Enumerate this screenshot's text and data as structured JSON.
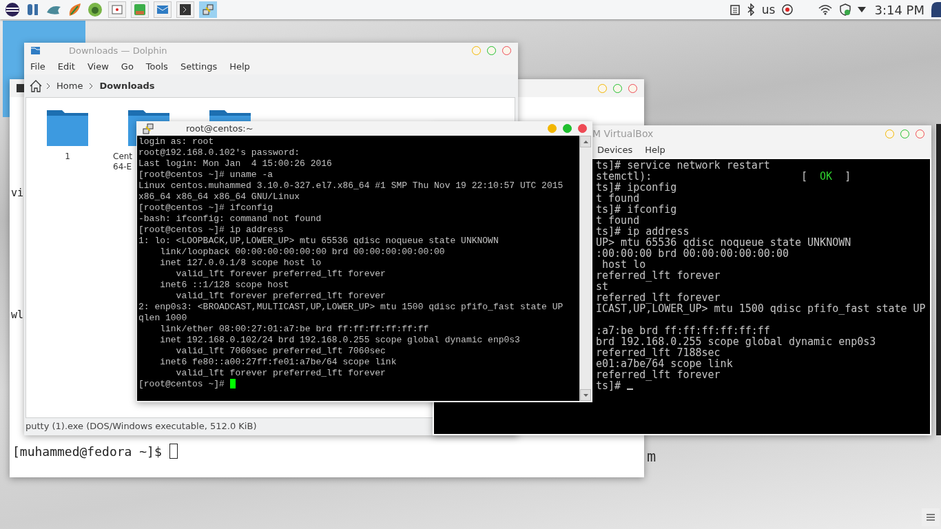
{
  "top_panel": {
    "tasks": [
      {
        "kind": "screenshot",
        "selected": false
      },
      {
        "kind": "calendar",
        "selected": false
      },
      {
        "kind": "mail",
        "selected": false
      },
      {
        "kind": "terminal",
        "selected": false
      },
      {
        "kind": "putty",
        "selected": true
      }
    ],
    "keyboard_layout": "us",
    "clock": "3:14 PM"
  },
  "back_terminal": {
    "active": false,
    "lines": [
      "vi",
      "wl"
    ],
    "prompt": {
      "text": "[muhammed@fedora ~]$",
      "cursor": true
    }
  },
  "desktop_fragment": "m",
  "dolphin": {
    "title": "Downloads — Dolphin",
    "active": false,
    "menu": [
      "File",
      "Edit",
      "View",
      "Go",
      "Tools",
      "Settings",
      "Help"
    ],
    "breadcrumb": [
      {
        "label": "Home",
        "current": false
      },
      {
        "label": "Downloads",
        "current": true
      }
    ],
    "items": [
      {
        "kind": "folder",
        "lines": [
          "1"
        ]
      },
      {
        "kind": "folder",
        "lines": [
          "Cent",
          "64-E"
        ]
      },
      {
        "kind": "folder"
      }
    ],
    "status": "putty (1).exe (DOS/Windows executable, 512.0 KiB)"
  },
  "virtualbox": {
    "title": "M VirtualBox",
    "active": false,
    "menu": [
      "Devices",
      "Help"
    ],
    "lines": [
      {
        "kind": "text",
        "text": "ts]# service network restart"
      },
      {
        "kind": "status",
        "text": "stemctl):",
        "open": "[",
        "status": "OK",
        "close": "]"
      },
      {
        "kind": "text",
        "text": "ts]# ipconfig"
      },
      {
        "kind": "text",
        "text": "t found"
      },
      {
        "kind": "text",
        "text": "ts]# ifconfig"
      },
      {
        "kind": "text",
        "text": "t found"
      },
      {
        "kind": "text",
        "text": "ts]# ip address"
      },
      {
        "kind": "text",
        "text": "UP> mtu 65536 qdisc noqueue state UNKNOWN"
      },
      {
        "kind": "text",
        "text": ":00:00:00 brd 00:00:00:00:00:00"
      },
      {
        "kind": "text",
        "text": " host lo"
      },
      {
        "kind": "text",
        "text": "referred_lft forever"
      },
      {
        "kind": "text",
        "text": "st"
      },
      {
        "kind": "text",
        "text": "referred_lft forever"
      },
      {
        "kind": "text",
        "text": "ICAST,UP,LOWER_UP> mtu 1500 qdisc pfifo_fast state UP"
      },
      {
        "kind": "blank"
      },
      {
        "kind": "text",
        "text": ":a7:be brd ff:ff:ff:ff:ff:ff"
      },
      {
        "kind": "text",
        "text": "brd 192.168.0.255 scope global dynamic enp0s3"
      },
      {
        "kind": "text",
        "text": "referred_lft 7188sec"
      },
      {
        "kind": "text",
        "text": "e01:a7be/64 scope link"
      },
      {
        "kind": "text",
        "text": "referred_lft forever"
      },
      {
        "kind": "prompt",
        "text": "ts]#",
        "cursor": true
      }
    ]
  },
  "putty": {
    "title": "root@centos:~",
    "active": true,
    "lines": [
      "login as: root",
      "root@192.168.0.102's password:",
      "Last login: Mon Jan  4 15:00:26 2016",
      "[root@centos ~]# uname -a",
      "Linux centos.muhammed 3.10.0-327.el7.x86_64 #1 SMP Thu Nov 19 22:10:57 UTC 2015",
      "x86_64 x86_64 x86_64 GNU/Linux",
      "[root@centos ~]# ifconfig",
      "-bash: ifconfig: command not found",
      "[root@centos ~]# ip address",
      "1: lo: <LOOPBACK,UP,LOWER_UP> mtu 65536 qdisc noqueue state UNKNOWN",
      "    link/loopback 00:00:00:00:00:00 brd 00:00:00:00:00:00",
      "    inet 127.0.0.1/8 scope host lo",
      "       valid_lft forever preferred_lft forever",
      "    inet6 ::1/128 scope host",
      "       valid_lft forever preferred_lft forever",
      "2: enp0s3: <BROADCAST,MULTICAST,UP,LOWER_UP> mtu 1500 qdisc pfifo_fast state UP",
      "qlen 1000",
      "    link/ether 08:00:27:01:a7:be brd ff:ff:ff:ff:ff:ff",
      "    inet 192.168.0.102/24 brd 192.168.0.255 scope global dynamic enp0s3",
      "       valid_lft 7060sec preferred_lft 7060sec",
      "    inet6 fe80::a00:27ff:fe01:a7be/64 scope link",
      "       valid_lft forever preferred_lft forever"
    ],
    "prompt": {
      "text": "[root@centos ~]#",
      "cursor": true
    }
  }
}
